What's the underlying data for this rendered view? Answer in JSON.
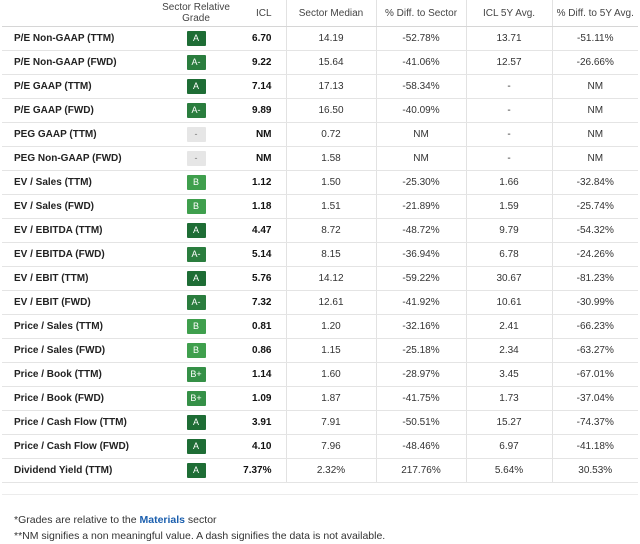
{
  "headers": {
    "metric": "",
    "grade": "Sector Relative Grade",
    "icl": "ICL",
    "sector_median": "Sector Median",
    "diff_sector": "% Diff. to Sector",
    "icl_5y": "ICL 5Y Avg.",
    "diff_5y": "% Diff. to 5Y Avg."
  },
  "rows": [
    {
      "metric": "P/E Non-GAAP (TTM)",
      "grade": "A",
      "grade_class": "g-A",
      "icl": "6.70",
      "sector_median": "14.19",
      "diff_sector": "-52.78%",
      "icl_5y": "13.71",
      "diff_5y": "-51.11%"
    },
    {
      "metric": "P/E Non-GAAP (FWD)",
      "grade": "A-",
      "grade_class": "g-Aminus",
      "icl": "9.22",
      "sector_median": "15.64",
      "diff_sector": "-41.06%",
      "icl_5y": "12.57",
      "diff_5y": "-26.66%"
    },
    {
      "metric": "P/E GAAP (TTM)",
      "grade": "A",
      "grade_class": "g-A",
      "icl": "7.14",
      "sector_median": "17.13",
      "diff_sector": "-58.34%",
      "icl_5y": "-",
      "diff_5y": "NM"
    },
    {
      "metric": "P/E GAAP (FWD)",
      "grade": "A-",
      "grade_class": "g-Aminus",
      "icl": "9.89",
      "sector_median": "16.50",
      "diff_sector": "-40.09%",
      "icl_5y": "-",
      "diff_5y": "NM"
    },
    {
      "metric": "PEG GAAP (TTM)",
      "grade": "-",
      "grade_class": "g-none",
      "icl": "NM",
      "sector_median": "0.72",
      "diff_sector": "NM",
      "icl_5y": "-",
      "diff_5y": "NM"
    },
    {
      "metric": "PEG Non-GAAP (FWD)",
      "grade": "-",
      "grade_class": "g-none",
      "icl": "NM",
      "sector_median": "1.58",
      "diff_sector": "NM",
      "icl_5y": "-",
      "diff_5y": "NM"
    },
    {
      "metric": "EV / Sales (TTM)",
      "grade": "B",
      "grade_class": "g-B",
      "icl": "1.12",
      "sector_median": "1.50",
      "diff_sector": "-25.30%",
      "icl_5y": "1.66",
      "diff_5y": "-32.84%"
    },
    {
      "metric": "EV / Sales (FWD)",
      "grade": "B",
      "grade_class": "g-B",
      "icl": "1.18",
      "sector_median": "1.51",
      "diff_sector": "-21.89%",
      "icl_5y": "1.59",
      "diff_5y": "-25.74%"
    },
    {
      "metric": "EV / EBITDA (TTM)",
      "grade": "A",
      "grade_class": "g-A",
      "icl": "4.47",
      "sector_median": "8.72",
      "diff_sector": "-48.72%",
      "icl_5y": "9.79",
      "diff_5y": "-54.32%"
    },
    {
      "metric": "EV / EBITDA (FWD)",
      "grade": "A-",
      "grade_class": "g-Aminus",
      "icl": "5.14",
      "sector_median": "8.15",
      "diff_sector": "-36.94%",
      "icl_5y": "6.78",
      "diff_5y": "-24.26%"
    },
    {
      "metric": "EV / EBIT (TTM)",
      "grade": "A",
      "grade_class": "g-A",
      "icl": "5.76",
      "sector_median": "14.12",
      "diff_sector": "-59.22%",
      "icl_5y": "30.67",
      "diff_5y": "-81.23%"
    },
    {
      "metric": "EV / EBIT (FWD)",
      "grade": "A-",
      "grade_class": "g-Aminus",
      "icl": "7.32",
      "sector_median": "12.61",
      "diff_sector": "-41.92%",
      "icl_5y": "10.61",
      "diff_5y": "-30.99%"
    },
    {
      "metric": "Price / Sales (TTM)",
      "grade": "B",
      "grade_class": "g-B",
      "icl": "0.81",
      "sector_median": "1.20",
      "diff_sector": "-32.16%",
      "icl_5y": "2.41",
      "diff_5y": "-66.23%"
    },
    {
      "metric": "Price / Sales (FWD)",
      "grade": "B",
      "grade_class": "g-B",
      "icl": "0.86",
      "sector_median": "1.15",
      "diff_sector": "-25.18%",
      "icl_5y": "2.34",
      "diff_5y": "-63.27%"
    },
    {
      "metric": "Price / Book (TTM)",
      "grade": "B+",
      "grade_class": "g-Bplus",
      "icl": "1.14",
      "sector_median": "1.60",
      "diff_sector": "-28.97%",
      "icl_5y": "3.45",
      "diff_5y": "-67.01%"
    },
    {
      "metric": "Price / Book (FWD)",
      "grade": "B+",
      "grade_class": "g-Bplus",
      "icl": "1.09",
      "sector_median": "1.87",
      "diff_sector": "-41.75%",
      "icl_5y": "1.73",
      "diff_5y": "-37.04%"
    },
    {
      "metric": "Price / Cash Flow (TTM)",
      "grade": "A",
      "grade_class": "g-A",
      "icl": "3.91",
      "sector_median": "7.91",
      "diff_sector": "-50.51%",
      "icl_5y": "15.27",
      "diff_5y": "-74.37%"
    },
    {
      "metric": "Price / Cash Flow (FWD)",
      "grade": "A",
      "grade_class": "g-A",
      "icl": "4.10",
      "sector_median": "7.96",
      "diff_sector": "-48.46%",
      "icl_5y": "6.97",
      "diff_5y": "-41.18%"
    },
    {
      "metric": "Dividend Yield (TTM)",
      "grade": "A",
      "grade_class": "g-A",
      "icl": "7.37%",
      "sector_median": "2.32%",
      "diff_sector": "217.76%",
      "icl_5y": "5.64%",
      "diff_5y": "30.53%"
    }
  ],
  "footnotes": {
    "line1_prefix": "*Grades are relative to the ",
    "line1_link": "Materials",
    "line1_suffix": " sector",
    "line2": "**NM signifies a non meaningful value. A dash signifies the data is not available."
  },
  "colors": {
    "grade_A": "#1e6d35",
    "grade_A_minus": "#2a7d3e",
    "grade_B_plus": "#359047",
    "grade_B": "#3f9f4d",
    "grade_none": "#e6e6e6",
    "link": "#1b5fae"
  }
}
